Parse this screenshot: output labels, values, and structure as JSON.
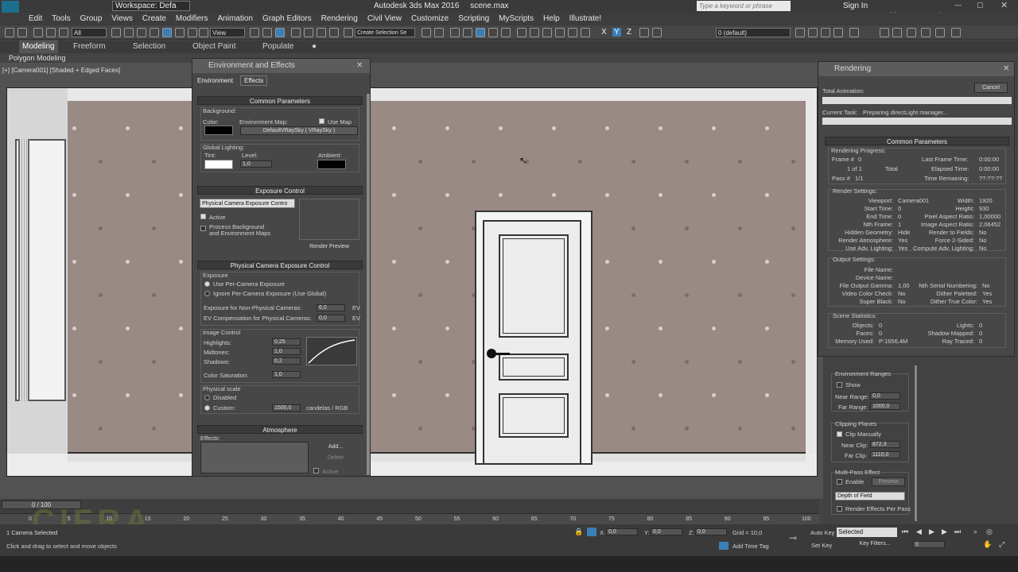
{
  "window": {
    "title": "Autodesk 3ds Max 2016",
    "file": "scene.max",
    "workspace": "Workspace: Defa",
    "search_placeholder": "Type a keyword or phrase",
    "sign_in": "Sign In",
    "watermark": "cifranagazine.com"
  },
  "menu": [
    "Edit",
    "Tools",
    "Group",
    "Views",
    "Create",
    "Modifiers",
    "Animation",
    "Graph Editors",
    "Rendering",
    "Civil View",
    "Customize",
    "Scripting",
    "MyScripts",
    "Help",
    "Illustrate!"
  ],
  "toolbar": {
    "selection_filter": "All",
    "ref_coord": "View",
    "selection_set": "Create Selection Se",
    "layer": "0 (default)"
  },
  "ribbon": {
    "tabs": [
      "Modeling",
      "Freeform",
      "Selection",
      "Object Paint",
      "Populate"
    ],
    "sub": "Polygon Modeling"
  },
  "viewport": {
    "label": "[+] [Camera001] [Shaded + Edged Faces]"
  },
  "env_dialog": {
    "title": "Environment and Effects",
    "tabs": [
      "Environment",
      "Effects"
    ],
    "common_params": "Common Parameters",
    "background": "Background:",
    "color": "Color:",
    "env_map": "Environment Map:",
    "use_map": "Use Map",
    "map_name": "DefaultVRaySky  ( VRaySky )",
    "global_lighting": "Global Lighting:",
    "tint": "Tint:",
    "level": "Level:",
    "level_val": "1,0",
    "ambient": "Ambient:",
    "exposure_control": "Exposure Control",
    "exposure_type": "Physical Camera Exposure Contro",
    "active": "Active",
    "process_bg": "Process Background",
    "process_bg2": "and Environment Maps",
    "render_preview": "Render Preview",
    "phys_head": "Physical Camera Exposure Control",
    "exposure": "Exposure",
    "use_per_camera": "Use Per-Camera Exposure",
    "ignore_per_camera": "Ignore Per-Camera Exposure (Use Global)",
    "ev_non_phys": "Exposure for Non-Physical Cameras:",
    "ev_non_phys_val": "6,0",
    "ev_unit": "EV",
    "ev_comp": "EV Compensation for Physical Cameras:",
    "ev_comp_val": "0,0",
    "image_control": "Image Control",
    "highlights": "Highlights:",
    "highlights_val": "0,25",
    "midtones": "Midtones:",
    "midtones_val": "1,0",
    "shadows": "Shadows:",
    "shadows_val": "0,2",
    "color_sat": "Color Saturation:",
    "color_sat_val": "1,0",
    "physical_scale": "Physical scale",
    "disabled": "Disabled",
    "custom": "Custom:",
    "custom_val": "1500,0",
    "candelas": "candelas / RGB",
    "atmosphere": "Atmosphere",
    "effects": "Effects:",
    "add": "Add...",
    "delete": "Delete",
    "active2": "Active"
  },
  "render_dialog": {
    "title": "Rendering",
    "total_anim": "Total Animation:",
    "cancel": "Cancel",
    "current_task": "Current Task:",
    "task": "Preparing directLight manager...",
    "common": "Common Parameters",
    "progress": "Rendering Progress:",
    "frame": "Frame #",
    "frame_val": "0",
    "of": "1 of 1",
    "total": "Total",
    "pass": "Pass #",
    "pass_val": "1/1",
    "last_frame": "Last Frame Time:",
    "last_frame_val": "0:00:00",
    "elapsed": "Elapsed Time:",
    "elapsed_val": "0:00:00",
    "remaining": "Time Remaining:",
    "remaining_val": "??:??:??",
    "settings": "Render Settings:",
    "left_rows": [
      [
        "Viewport:",
        "Camera001"
      ],
      [
        "Start Time:",
        "0"
      ],
      [
        "End Time:",
        "0"
      ],
      [
        "Nth Frame:",
        "1"
      ],
      [
        "Hidden Geometry:",
        "Hide"
      ],
      [
        "Render Atmosphere:",
        "Yes"
      ],
      [
        "Use Adv. Lighting:",
        "Yes"
      ]
    ],
    "right_rows": [
      [
        "Width:",
        "1920"
      ],
      [
        "Height:",
        "930"
      ],
      [
        "Pixel Aspect Ratio:",
        "1,00000"
      ],
      [
        "Image Aspect Ratio:",
        "2,06452"
      ],
      [
        "Render to Fields:",
        "No"
      ],
      [
        "Force 2-Sided:",
        "No"
      ],
      [
        "Compute Adv. Lighting:",
        "No"
      ]
    ],
    "output": "Output Settings:",
    "out_left": [
      [
        "File Name:",
        ""
      ],
      [
        "Device Name:",
        ""
      ],
      [
        "File Output Gamma:",
        "1,00"
      ],
      [
        "Video Color Check:",
        "No"
      ],
      [
        "Super Black:",
        "No"
      ]
    ],
    "out_right": [
      [
        "Nth Serial Numbering:",
        "No"
      ],
      [
        "Dither Paletted:",
        "Yes"
      ],
      [
        "Dither True Color:",
        "Yes"
      ]
    ],
    "stats": "Scene Statistics:",
    "stat_left": [
      [
        "Objects:",
        "0"
      ],
      [
        "Faces:",
        "0"
      ],
      [
        "Memory Used:",
        "P:1656,4M"
      ]
    ],
    "stat_right": [
      [
        "Lights:",
        "0"
      ],
      [
        "Shadow Mapped:",
        "0"
      ],
      [
        "Ray Traced:",
        "0"
      ]
    ]
  },
  "camera_panel": {
    "env_ranges": "Environment Ranges",
    "show": "Show",
    "near_range": "Near Range:",
    "near_range_val": "0,0",
    "far_range": "Far Range:",
    "far_range_val": "1000,0",
    "clipping": "Clipping Planes",
    "clip_manually": "Clip Manually",
    "near_clip": "Near Clip:",
    "near_clip_val": "872,3",
    "far_clip": "Far Clip:",
    "far_clip_val": "1110,0",
    "multipass": "Multi-Pass Effect",
    "enable": "Enable",
    "preview": "Preview",
    "dof": "Depth of Field",
    "render_per_pass": "Render Effects Per Pass"
  },
  "timeline": {
    "frame": "0 / 100",
    "ticks": [
      "0",
      "5",
      "10",
      "15",
      "20",
      "25",
      "30",
      "35",
      "40",
      "45",
      "50",
      "55",
      "60",
      "65",
      "70",
      "75",
      "80",
      "85",
      "90",
      "95",
      "100"
    ]
  },
  "status": {
    "selected": "1 Camera Selected",
    "prompt": "Click and drag to select and move objects",
    "x": "X:",
    "x_val": "0,0",
    "y": "Y:",
    "y_val": "0,0",
    "z": "Z:",
    "z_val": "0,0",
    "grid": "Grid = 10,0",
    "auto_key": "Auto Key",
    "set_key": "Set Key",
    "key_sel": "Selected",
    "key_filters": "Key Filters...",
    "add_time_tag": "Add Time Tag",
    "frame_field": "0"
  },
  "colors": {
    "wall": "#9a8a84",
    "bg": "#444444",
    "dot_light": "#d9cfca",
    "dot_dark": "#7d6c62"
  }
}
